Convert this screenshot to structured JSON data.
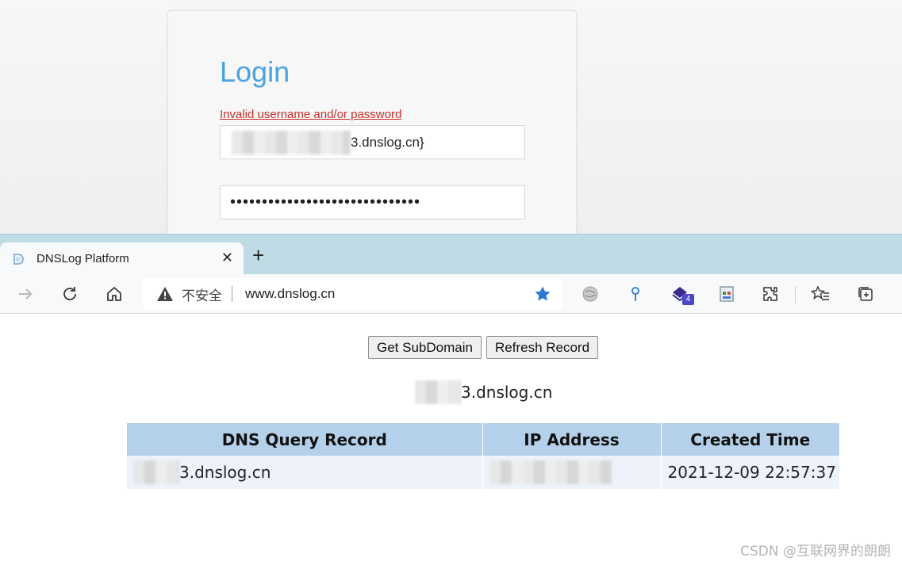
{
  "login": {
    "title": "Login",
    "error": "Invalid username and/or password",
    "username_visible_suffix": "3.dnslog.cn}",
    "password_mask": "••••••••••••••••••••••••••••••"
  },
  "browser": {
    "tab_title": "DNSLog Platform",
    "tab_close": "✕",
    "new_tab": "+",
    "insecure_label": "不安全",
    "url": "www.dnslog.cn",
    "extension_badge_count": "4",
    "accent_color": "#2a7ad5"
  },
  "page": {
    "buttons": {
      "get_subdomain": "Get SubDomain",
      "refresh_record": "Refresh Record"
    },
    "subdomain_visible_suffix": "3.dnslog.cn",
    "table": {
      "headers": [
        "DNS Query Record",
        "IP Address",
        "Created Time"
      ],
      "rows": [
        {
          "dns_record_visible_suffix": "3.dnslog.cn",
          "ip_address": "",
          "created_time": "2021-12-09 22:57:37"
        }
      ]
    }
  },
  "watermark": "CSDN @互联网界的朗朗"
}
